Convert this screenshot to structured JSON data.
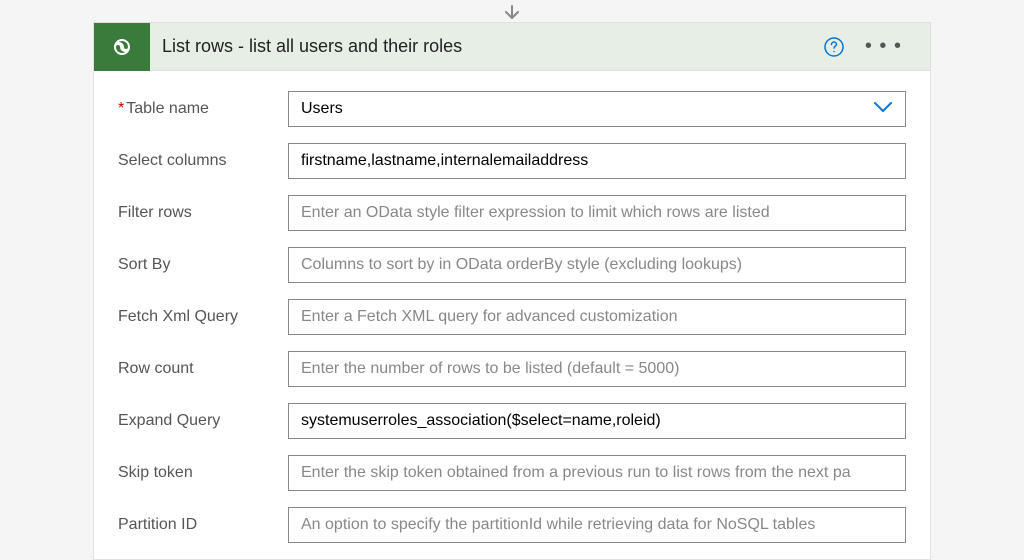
{
  "header": {
    "title": "List rows - list all users and their roles"
  },
  "fields": {
    "tableName": {
      "label": "Table name",
      "value": "Users"
    },
    "selectColumns": {
      "label": "Select columns",
      "value": "firstname,lastname,internalemailaddress"
    },
    "filterRows": {
      "label": "Filter rows",
      "placeholder": "Enter an OData style filter expression to limit which rows are listed"
    },
    "sortBy": {
      "label": "Sort By",
      "placeholder": "Columns to sort by in OData orderBy style (excluding lookups)"
    },
    "fetchXml": {
      "label": "Fetch Xml Query",
      "placeholder": "Enter a Fetch XML query for advanced customization"
    },
    "rowCount": {
      "label": "Row count",
      "placeholder": "Enter the number of rows to be listed (default = 5000)"
    },
    "expandQuery": {
      "label": "Expand Query",
      "value": "systemuserroles_association($select=name,roleid)"
    },
    "skipToken": {
      "label": "Skip token",
      "placeholder": "Enter the skip token obtained from a previous run to list rows from the next pa"
    },
    "partitionId": {
      "label": "Partition ID",
      "placeholder": "An option to specify the partitionId while retrieving data for NoSQL tables"
    }
  }
}
